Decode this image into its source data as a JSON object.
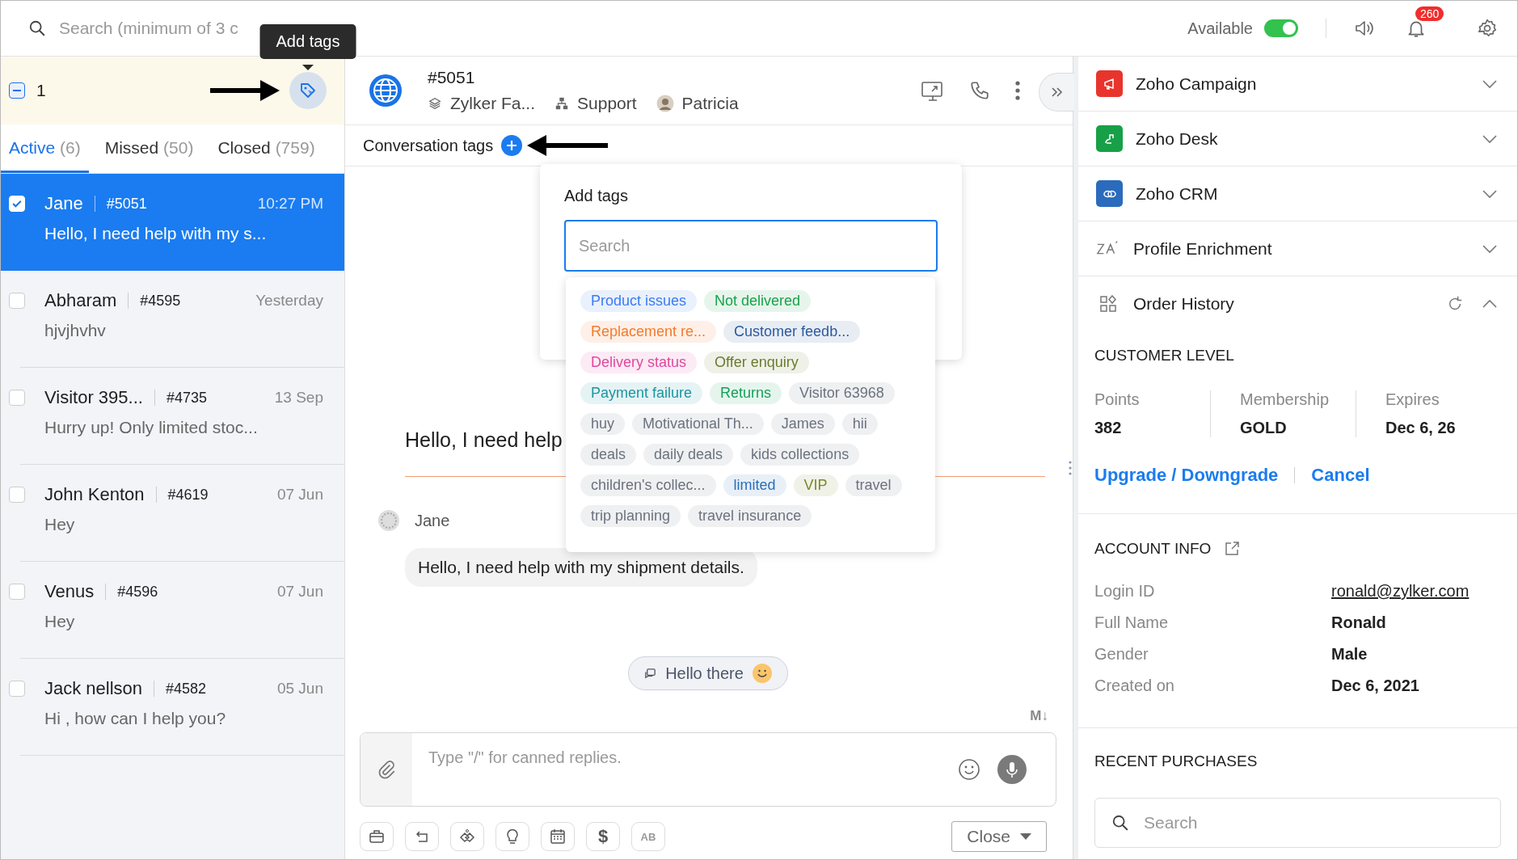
{
  "top_bar": {
    "search": {
      "placeholder": "Search (minimum of 3 c"
    },
    "status": "Available",
    "available": true,
    "notifications": "260"
  },
  "tooltip": "Add tags",
  "selection": {
    "indeterminate": true,
    "count": "1"
  },
  "tabs": [
    {
      "label": "Active",
      "count": "(6)",
      "selected": true
    },
    {
      "label": "Missed",
      "count": "(50)",
      "selected": false
    },
    {
      "label": "Closed",
      "count": "(759)",
      "selected": false
    }
  ],
  "conversations": [
    {
      "name": "Jane",
      "id": "#5051",
      "time": "10:27 PM",
      "preview": "Hello, I need help with my s...",
      "selected": true,
      "checked": true
    },
    {
      "name": "Abharam",
      "id": "#4595",
      "time": "Yesterday",
      "preview": "hjvjhvhv",
      "selected": false,
      "checked": false
    },
    {
      "name": "Visitor 395...",
      "id": "#4735",
      "time": "13 Sep",
      "preview": "Hurry up! Only limited stoc...",
      "selected": false,
      "checked": false
    },
    {
      "name": "John Kenton",
      "id": "#4619",
      "time": "07 Jun",
      "preview": "Hey",
      "selected": false,
      "checked": false
    },
    {
      "name": "Venus",
      "id": "#4596",
      "time": "07 Jun",
      "preview": "Hey",
      "selected": false,
      "checked": false
    },
    {
      "name": "Jack nellson",
      "id": "#4582",
      "time": "05 Jun",
      "preview": "Hi , how can I help you?",
      "selected": false,
      "checked": false
    }
  ],
  "chat": {
    "id": "#5051",
    "brand": "Zylker Fa...",
    "department": "Support",
    "agent": "Patricia",
    "tags_label": "Conversation tags",
    "headline": "Hello, I need help",
    "sender": "Jane",
    "message": "Hello, I need help with my shipment details.",
    "greeting": "Hello there",
    "markdown": "M↓",
    "composer_placeholder": "Type \"/\" for canned replies.",
    "currency_glyph": "$",
    "spell_glyph": "AB",
    "close_button": "Close"
  },
  "add_tags": {
    "title": "Add tags",
    "placeholder": "Search",
    "tags": [
      {
        "label": "Product issues",
        "color": "#3b7cf0"
      },
      {
        "label": "Not delivered",
        "color": "#17a34a"
      },
      {
        "label": "Replacement re...",
        "color": "#f47a2a"
      },
      {
        "label": "Customer feedb...",
        "color": "#2b5a9e"
      },
      {
        "label": "Delivery status",
        "color": "#e0489f"
      },
      {
        "label": "Offer enquiry",
        "color": "#6b7b30"
      },
      {
        "label": "Payment failure",
        "color": "#1a96a0"
      },
      {
        "label": "Returns",
        "color": "#15a05a"
      },
      {
        "label": "Visitor 63968",
        "color": "#6b7280"
      },
      {
        "label": "huy",
        "color": "#6b7280"
      },
      {
        "label": "Motivational Th...",
        "color": "#6b7280"
      },
      {
        "label": "James",
        "color": "#6b7280"
      },
      {
        "label": "hii",
        "color": "#6b7280"
      },
      {
        "label": "deals",
        "color": "#6b7280"
      },
      {
        "label": "daily deals",
        "color": "#6b7280"
      },
      {
        "label": "kids collections",
        "color": "#6b7280"
      },
      {
        "label": "children's collec...",
        "color": "#6b7280"
      },
      {
        "label": "limited",
        "color": "#2a6fb8"
      },
      {
        "label": "VIP",
        "color": "#788a2a"
      },
      {
        "label": "travel",
        "color": "#6b7280"
      },
      {
        "label": "trip planning",
        "color": "#6b7280"
      },
      {
        "label": "travel insurance",
        "color": "#6b7280"
      }
    ]
  },
  "sidebar": {
    "integrations": [
      {
        "label": "Zoho Campaign",
        "kind": "campaign",
        "color": "#e8342c",
        "expanded": false
      },
      {
        "label": "Zoho Desk",
        "kind": "desk",
        "color": "#18a048",
        "expanded": false
      },
      {
        "label": "Zoho CRM",
        "kind": "crm",
        "color": "#2b6bbd",
        "expanded": false
      },
      {
        "label": "Profile Enrichment",
        "kind": "enrichment",
        "expanded": false
      },
      {
        "label": "Order History",
        "kind": "orders",
        "expanded": true
      }
    ],
    "customer_level": {
      "title": "CUSTOMER LEVEL",
      "stats": [
        {
          "label": "Points",
          "value": "382"
        },
        {
          "label": "Membership",
          "value": "GOLD"
        },
        {
          "label": "Expires",
          "value": "Dec 6, 26"
        }
      ],
      "actions": [
        "Upgrade / Downgrade",
        "Cancel"
      ]
    },
    "account_info": {
      "title": "ACCOUNT INFO",
      "fields": [
        {
          "label": "Login ID",
          "value": "ronald@zylker.com",
          "kind": "link"
        },
        {
          "label": "Full Name",
          "value": "Ronald",
          "kind": "text"
        },
        {
          "label": "Gender",
          "value": "Male",
          "kind": "text"
        },
        {
          "label": "Created on",
          "value": "Dec 6, 2021",
          "kind": "text"
        }
      ]
    },
    "recent_purchases": {
      "title": "RECENT PURCHASES",
      "placeholder": "Search"
    }
  }
}
